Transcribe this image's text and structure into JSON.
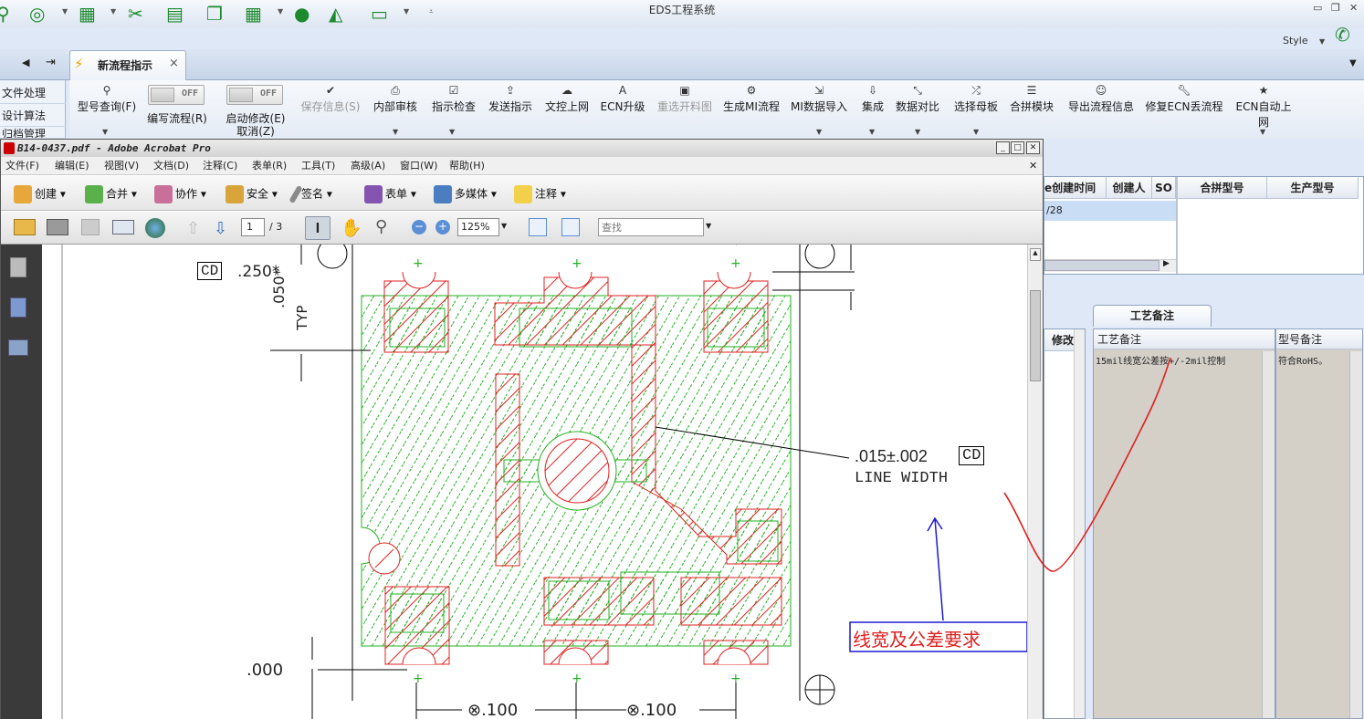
{
  "app": {
    "title": "EDS工程系统",
    "style_label": "Style"
  },
  "tab": {
    "label": "新流程指示",
    "close": "×"
  },
  "sidebar": {
    "items": [
      "文件处理",
      "设计算法",
      "归档管理"
    ]
  },
  "ribbon": {
    "model_query": "型号查询(F)",
    "toggle_off": "OFF",
    "edit_flow": "编写流程(R)",
    "start_modify": "启动修改(E)",
    "cancel": "取消(Z)",
    "save_info": "保存信息(S)",
    "internal_review": "内部审核",
    "instruction_check": "指示检查",
    "send_instruction": "发送指示",
    "upload": "文控上网",
    "ecn_upgrade": "ECN升级",
    "reselect_drawing": "重选开料图",
    "gen_mi_flow": "生成MI流程",
    "mi_import": "MI数据导入",
    "integrate": "集成",
    "data_compare": "数据对比",
    "select_mother": "选择母板",
    "merge_module": "合拼模块",
    "export_flow": "导出流程信息",
    "fix_ecn": "修复ECN丢流程",
    "ecn_auto": "ECN自动上网"
  },
  "grid_top": {
    "headers": [
      "e创建时间",
      "创建人",
      "SO",
      "合拼型号",
      "生产型号"
    ],
    "row_value": "/28"
  },
  "grid_bottom": {
    "tab_label": "工艺备注",
    "modify_header": "修改",
    "process_header": "工艺备注",
    "model_header": "型号备注",
    "process_value": "15mil线宽公差按+/-2mil控制",
    "model_value": "符合RoHS。"
  },
  "acrobat": {
    "title": "B14-0437.pdf - Adobe Acrobat Pro",
    "menu": [
      "文件(F)",
      "编辑(E)",
      "视图(V)",
      "文档(D)",
      "注释(C)",
      "表单(R)",
      "工具(T)",
      "高级(A)",
      "窗口(W)",
      "帮助(H)"
    ],
    "toolbar": [
      "创建",
      "合并",
      "协作",
      "安全",
      "签名",
      "表单",
      "多媒体",
      "注释"
    ],
    "page_current": "1",
    "page_total": "/ 3",
    "zoom": "125%",
    "search_placeholder": "查找"
  },
  "drawing": {
    "cd": "CD",
    "top_dim": ".250*",
    "side_dim": ".050*",
    "typ": "TYP",
    "line_width_value": ".015±.002",
    "line_width_label": "LINE WIDTH",
    "zero": ".000",
    "bottom_dim_1": "⊗.100",
    "bottom_dim_2": "⊗.100",
    "annotation": "线宽及公差要求"
  },
  "colors": {
    "accent_green": "#1d8a2e",
    "copper_red": "#e02020",
    "mask_green": "#22b022",
    "annotation_blue": "#1a1ad0"
  }
}
